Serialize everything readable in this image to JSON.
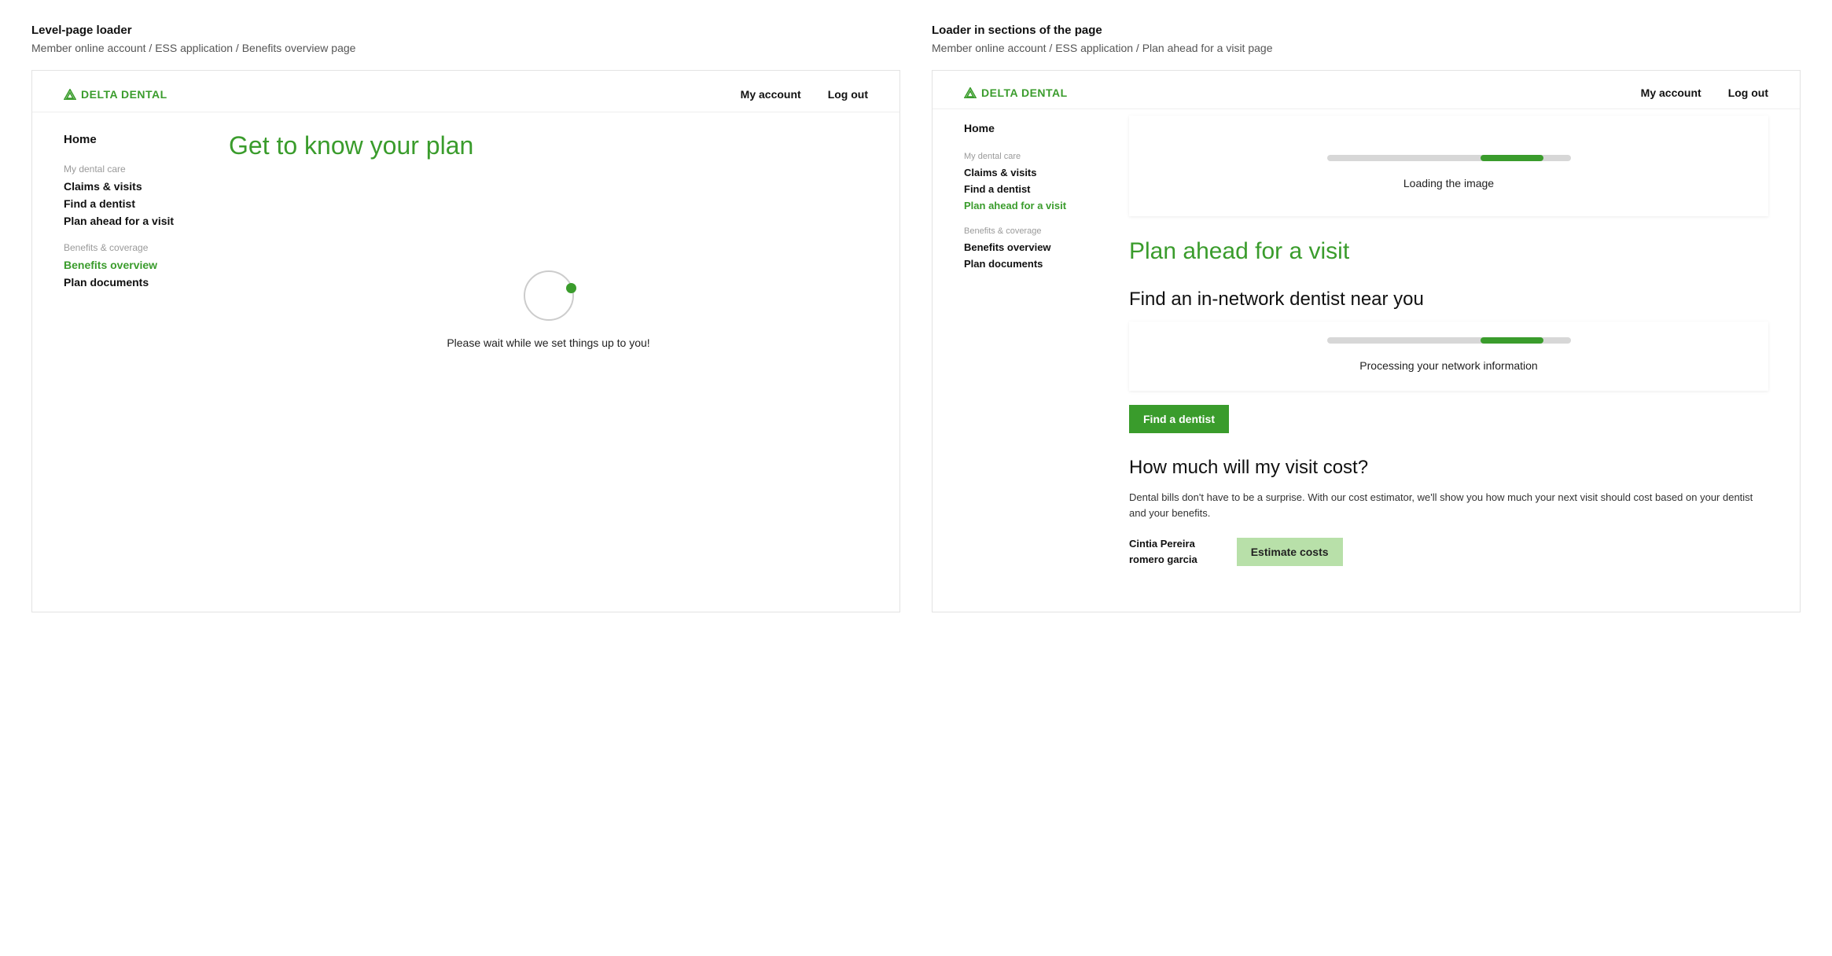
{
  "left": {
    "spec_title": "Level-page loader",
    "spec_sub": "Member online account / ESS application / Benefits overview page",
    "brand": "DELTA DENTAL",
    "top_links": {
      "account": "My account",
      "logout": "Log out"
    },
    "nav": {
      "home": "Home",
      "group1_label": "My dental care",
      "group1_items": [
        "Claims & visits",
        "Find a dentist",
        "Plan ahead for a visit"
      ],
      "group2_label": "Benefits & coverage",
      "group2_items": [
        "Benefits overview",
        "Plan documents"
      ],
      "active": "Benefits overview"
    },
    "page_title": "Get to know your plan",
    "spinner_text": "Please wait while we set things up to you!"
  },
  "right": {
    "spec_title": "Loader in sections of the page",
    "spec_sub": "Member online account / ESS application / Plan ahead for a visit page",
    "brand": "DELTA DENTAL",
    "top_links": {
      "account": "My account",
      "logout": "Log out"
    },
    "nav": {
      "home": "Home",
      "group1_label": "My dental care",
      "group1_items": [
        "Claims & visits",
        "Find a dentist",
        "Plan ahead for a visit"
      ],
      "group2_label": "Benefits & coverage",
      "group2_items": [
        "Benefits overview",
        "Plan documents"
      ],
      "active": "Plan ahead for a visit"
    },
    "card1_text": "Loading the image",
    "page_title": "Plan ahead for a visit",
    "h2_find": "Find an in-network dentist near you",
    "card2_text": "Processing your network information",
    "find_btn": "Find a dentist",
    "h2_cost": "How much will my visit cost?",
    "cost_desc": "Dental bills don't have to be a surprise. With our cost estimator, we'll show you how much your next visit should cost based on your dentist and your benefits.",
    "user_line1": "Cintia Pereira",
    "user_line2": "romero garcia",
    "estimate_btn": "Estimate costs"
  }
}
